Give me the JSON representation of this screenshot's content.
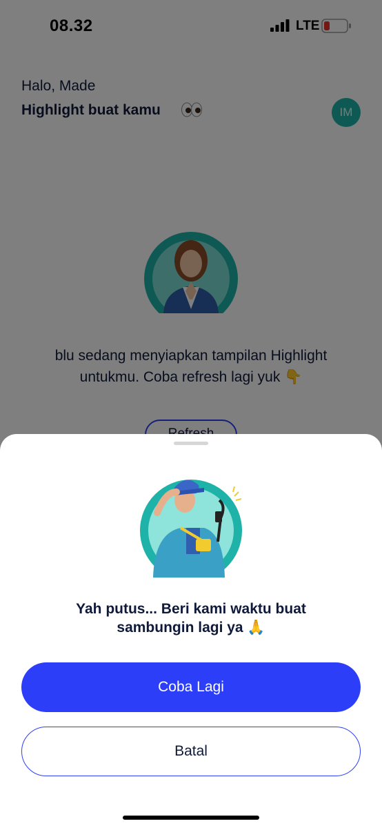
{
  "status_bar": {
    "time": "08.32",
    "network": "LTE"
  },
  "header": {
    "greeting": "Halo, Made",
    "title": "Highlight buat kamu",
    "title_icon": "eyes-icon",
    "avatar_initials": "IM"
  },
  "main": {
    "illustration": "woman-praying-illustration",
    "message": "blu sedang menyiapkan tampilan Highlight untukmu. Coba refresh lagi yuk 👇",
    "refresh_label": "Refresh"
  },
  "sheet": {
    "illustration": "man-with-cable-illustration",
    "message": "Yah putus... Beri kami waktu buat sambungin lagi ya 🙏",
    "retry_label": "Coba Lagi",
    "cancel_label": "Batal"
  },
  "colors": {
    "primary": "#2c3ef7",
    "teal": "#1fb2a8",
    "text": "#0f1a3a",
    "overlay": "rgba(0,0,0,0.5)"
  }
}
